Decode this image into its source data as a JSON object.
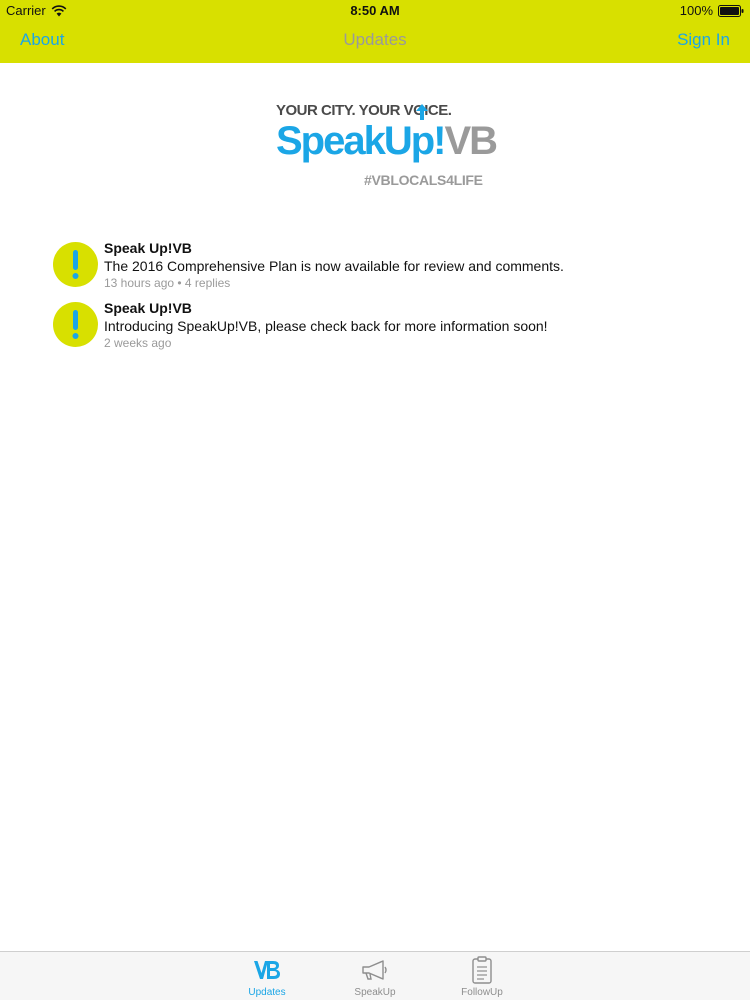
{
  "status_bar": {
    "carrier": "Carrier",
    "time": "8:50 AM",
    "battery": "100%"
  },
  "nav": {
    "left_label": "About",
    "title": "Updates",
    "right_label": "Sign In"
  },
  "logo": {
    "tagline": "YOUR CITY. YOUR VOICE.",
    "name_part1": "SpeakUp!",
    "name_part2": "VB",
    "hashtag": "#VBLOCALS4LIFE"
  },
  "feed": [
    {
      "author": "Speak Up!VB",
      "message": "The 2016 Comprehensive Plan is now available for review and comments.",
      "meta": "13 hours ago • 4 replies"
    },
    {
      "author": "Speak Up!VB",
      "message": "Introducing SpeakUp!VB, please check back for more information soon!",
      "meta": "2 weeks ago"
    }
  ],
  "tabs": [
    {
      "label": "Updates",
      "icon": "vb-icon",
      "active": true
    },
    {
      "label": "SpeakUp",
      "icon": "megaphone-icon",
      "active": false
    },
    {
      "label": "FollowUp",
      "icon": "clipboard-icon",
      "active": false
    }
  ],
  "colors": {
    "accent_yellow": "#d8e000",
    "accent_blue": "#1ba6e6",
    "muted_gray": "#9a9a9a"
  }
}
